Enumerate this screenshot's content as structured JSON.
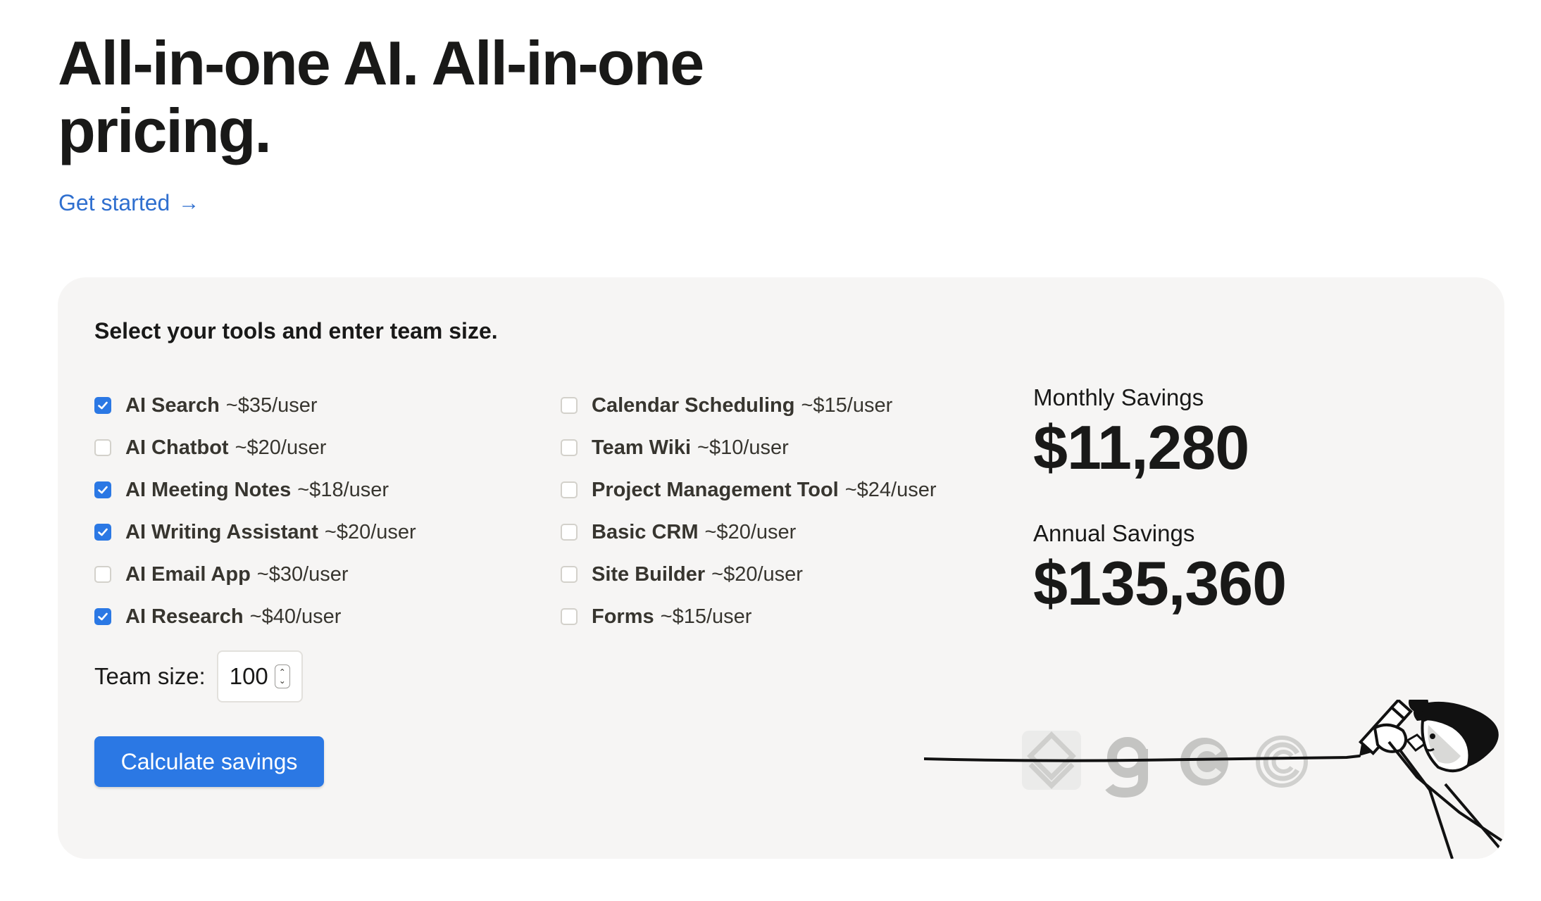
{
  "hero": {
    "title": "All-in-one AI. All-in-one pricing.",
    "cta_label": "Get started",
    "cta_arrow": "→"
  },
  "calculator": {
    "title": "Select your tools and enter team size.",
    "tools_left": [
      {
        "name": "AI Search",
        "price": "~$35/user",
        "checked": true
      },
      {
        "name": "AI Chatbot",
        "price": "~$20/user",
        "checked": false
      },
      {
        "name": "AI Meeting Notes",
        "price": "~$18/user",
        "checked": true
      },
      {
        "name": "AI Writing Assistant",
        "price": "~$20/user",
        "checked": true
      },
      {
        "name": "AI Email App",
        "price": "~$30/user",
        "checked": false
      },
      {
        "name": "AI Research",
        "price": "~$40/user",
        "checked": true
      }
    ],
    "tools_right": [
      {
        "name": "Calendar Scheduling",
        "price": "~$15/user",
        "checked": false
      },
      {
        "name": "Team Wiki",
        "price": "~$10/user",
        "checked": false
      },
      {
        "name": "Project Management Tool",
        "price": "~$24/user",
        "checked": false
      },
      {
        "name": "Basic CRM",
        "price": "~$20/user",
        "checked": false
      },
      {
        "name": "Site Builder",
        "price": "~$20/user",
        "checked": false
      },
      {
        "name": "Forms",
        "price": "~$15/user",
        "checked": false
      }
    ],
    "team_size_label": "Team size:",
    "team_size_value": "100",
    "calculate_label": "Calculate savings",
    "monthly_label": "Monthly Savings",
    "monthly_value": "$11,280",
    "annual_label": "Annual Savings",
    "annual_value": "$135,360"
  },
  "colors": {
    "accent": "#2b78e4",
    "link": "#2f6fcf",
    "card_bg": "#f6f5f4",
    "text": "#191918"
  },
  "icons": {
    "illustration": [
      "stacked-layers-logo-icon",
      "g-logo-icon",
      "c-logo-icon",
      "double-c-logo-icon",
      "person-drawing-line-illustration"
    ]
  }
}
